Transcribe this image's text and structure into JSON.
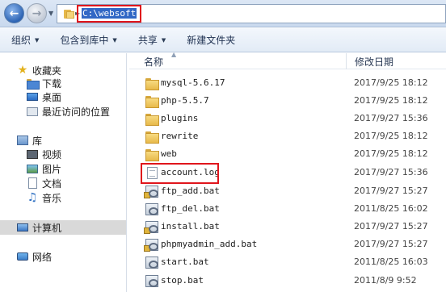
{
  "address_bar": {
    "path": "C:\\websoft"
  },
  "toolbar": {
    "organize": "组织",
    "include_in_library": "包含到库中",
    "share": "共享",
    "new_folder": "新建文件夹"
  },
  "sidebar": {
    "favorites": "收藏夹",
    "downloads": "下载",
    "desktop": "桌面",
    "recent": "最近访问的位置",
    "libraries": "库",
    "videos": "视频",
    "pictures": "图片",
    "documents": "文档",
    "music": "音乐",
    "computer": "计算机",
    "network": "网络"
  },
  "file_list": {
    "col_name": "名称",
    "col_modified": "修改日期",
    "rows": [
      {
        "name": "mysql-5.6.17",
        "date": "2017/9/25 18:12",
        "type": "folder"
      },
      {
        "name": "php-5.5.7",
        "date": "2017/9/25 18:12",
        "type": "folder"
      },
      {
        "name": "plugins",
        "date": "2017/9/27 15:36",
        "type": "folder"
      },
      {
        "name": "rewrite",
        "date": "2017/9/25 18:12",
        "type": "folder"
      },
      {
        "name": "web",
        "date": "2017/9/25 18:12",
        "type": "folder"
      },
      {
        "name": "account.log",
        "date": "2017/9/27 15:36",
        "type": "log"
      },
      {
        "name": "ftp_add.bat",
        "date": "2017/9/27 15:27",
        "type": "bat"
      },
      {
        "name": "ftp_del.bat",
        "date": "2011/8/25 16:02",
        "type": "bat"
      },
      {
        "name": "install.bat",
        "date": "2017/9/27 15:27",
        "type": "bat"
      },
      {
        "name": "phpmyadmin_add.bat",
        "date": "2017/9/27 15:27",
        "type": "bat"
      },
      {
        "name": "start.bat",
        "date": "2011/8/25 16:03",
        "type": "bat"
      },
      {
        "name": "stop.bat",
        "date": "2011/8/9 9:52",
        "type": "bat"
      }
    ]
  },
  "colors": {
    "annotation_red": "#e0151c",
    "selection_blue": "#3167c5",
    "toolbar_bg": "#e2ebf6"
  }
}
